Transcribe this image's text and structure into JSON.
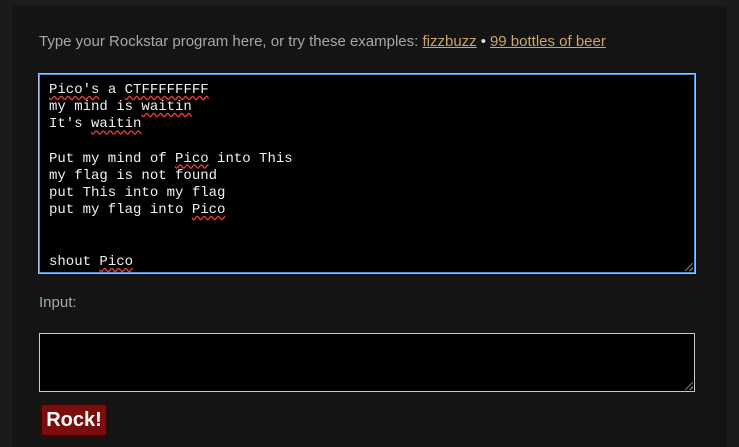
{
  "intro": {
    "text": "Type your Rockstar program here, or try these examples:",
    "example_1": "fizzbuzz",
    "separator": "•",
    "example_2": "99 bottles of beer"
  },
  "editor": {
    "lines": [
      [
        {
          "t": "Pico's",
          "sq": true
        },
        {
          "t": " a "
        },
        {
          "t": "CTFFFFFFFF",
          "sq": true
        }
      ],
      [
        {
          "t": "my mind is "
        },
        {
          "t": "waitin",
          "sq": true
        }
      ],
      [
        {
          "t": "It's "
        },
        {
          "t": "waitin",
          "sq": true
        }
      ],
      [
        {
          "t": ""
        }
      ],
      [
        {
          "t": "Put my mind of "
        },
        {
          "t": "Pico",
          "sq": true
        },
        {
          "t": " into This"
        }
      ],
      [
        {
          "t": "my flag is not found"
        }
      ],
      [
        {
          "t": "put This into my flag"
        }
      ],
      [
        {
          "t": "put my flag into "
        },
        {
          "t": "Pico",
          "sq": true
        }
      ],
      [
        {
          "t": ""
        }
      ],
      [
        {
          "t": ""
        }
      ],
      [
        {
          "t": "shout "
        },
        {
          "t": "Pico",
          "sq": true
        }
      ]
    ]
  },
  "input": {
    "label": "Input:",
    "value": ""
  },
  "run_button": {
    "label": "Rock!"
  }
}
